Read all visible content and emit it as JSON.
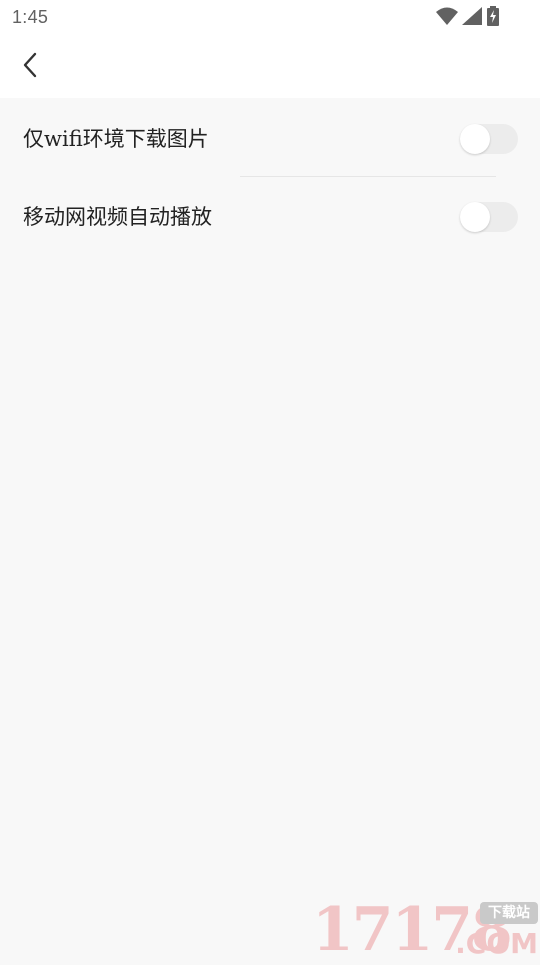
{
  "status_bar": {
    "time": "1:45",
    "icons": [
      "wifi-icon",
      "cell-signal-icon",
      "battery-charging-icon"
    ],
    "icon_color": "#616161"
  },
  "header": {
    "back_icon": "chevron-left-icon"
  },
  "settings": [
    {
      "label": "仅wifi环境下载图片",
      "enabled": false
    },
    {
      "label": "移动网视频自动播放",
      "enabled": false
    }
  ],
  "watermark": {
    "digits": "17178",
    "badge": "下载站",
    "suffix": ".COM"
  },
  "colors": {
    "background": "#f8f8f8",
    "surface": "#ffffff",
    "text_primary": "#222222",
    "toggle_track_off": "#ececec",
    "watermark_pink": "#f1c5c6"
  }
}
